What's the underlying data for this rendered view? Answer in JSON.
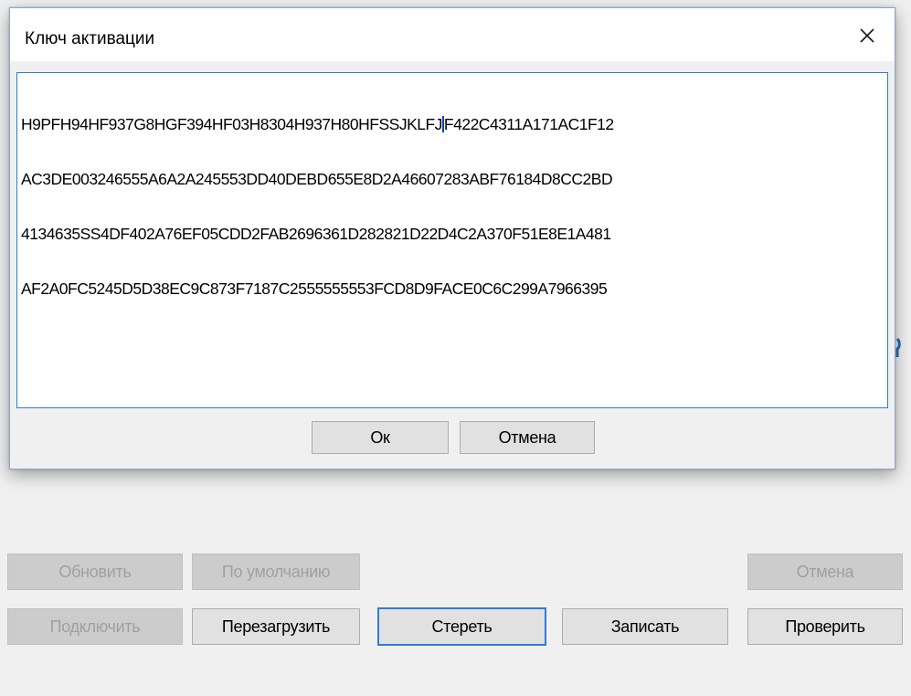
{
  "dialog": {
    "title": "Ключ активации",
    "key_lines": [
      "H9PFH94HF937G8HGF394HF03H8304H937H80HFSSJKLFJ",
      "F422C4311A171AC1F12",
      "AC3DE003246555A6A2A245553DD40DEBD655E8D2A46607283ABF76184D8CC2BD",
      "4134635SS4DF402A76EF05CDD2FAB2696361D282821D22D4C2A370F51E8E1A481",
      "AF2A0FC5245D5D38EC9C873F7187C2555555553FCD8D9FACE0C6C299A7966395"
    ],
    "ok_label": "Ок",
    "cancel_label": "Отмена"
  },
  "background_buttons": {
    "refresh_label": "Обновить",
    "defaults_label": "По умолчанию",
    "cancel_label": "Отмена",
    "connect_label": "Подключить",
    "reload_label": "Перезагрузить",
    "erase_label": "Стереть",
    "write_label": "Записать",
    "verify_label": "Проверить"
  },
  "colors": {
    "accent": "#2f7bd8",
    "window_bg": "#f0f0f0",
    "button_bg": "#e1e1e1",
    "disabled_text": "#a0a0a0"
  },
  "icons": {
    "close": "close-icon"
  }
}
